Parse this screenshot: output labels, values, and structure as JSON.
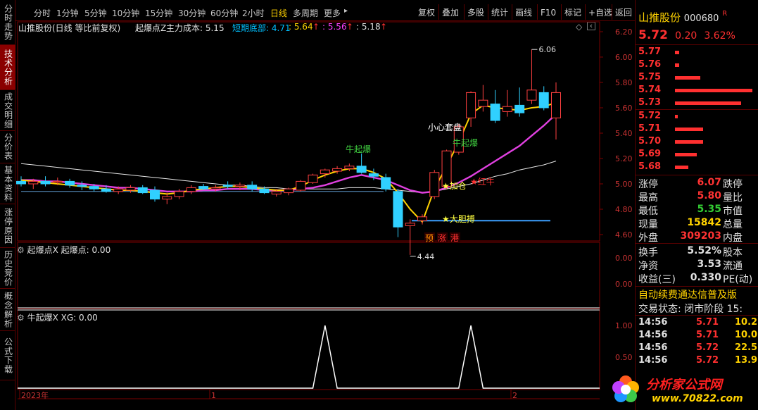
{
  "left_tabs": [
    {
      "label": "分时走势",
      "active": false
    },
    {
      "label": "技术分析",
      "active": true
    },
    {
      "label": "成交明细",
      "active": false
    },
    {
      "label": "分价表",
      "active": false
    },
    {
      "label": "基本资料",
      "active": false
    },
    {
      "label": "涨停原因",
      "active": false
    },
    {
      "label": "历史竞价",
      "active": false
    },
    {
      "label": "概念解析",
      "active": false
    },
    {
      "label": "公式下载",
      "active": false
    }
  ],
  "toolbar": {
    "periods": [
      "分时",
      "1分钟",
      "5分钟",
      "10分钟",
      "15分钟",
      "30分钟",
      "60分钟",
      "2小时",
      "日线",
      "多周期",
      "更多"
    ],
    "active_period": "日线",
    "more_arrow": "▸",
    "buttons": [
      "复权",
      "叠加",
      "多股",
      "统计",
      "画线",
      "F10",
      "标记",
      "+自选",
      "返回"
    ]
  },
  "header": {
    "title": "山推股份(日线 等比前复权)",
    "indicator_name": "起爆点Z",
    "cost_label": "主力成本: 5.15",
    "bottom_label": "短期底部: 4.71",
    "v1": ": 5.64",
    "v2": ": 5.56",
    "v3": ": 5.18",
    "arrow": "↑"
  },
  "chart": {
    "y_ticks": [
      "6.20",
      "6.00",
      "5.80",
      "5.60",
      "5.40",
      "5.20",
      "5.00",
      "4.80",
      "4.60"
    ],
    "high_label": "6.06",
    "low_label": "4.44",
    "annotations": {
      "xiaoxin": "小心套盘",
      "niu1": "牛起爆",
      "niu2": "牛起爆",
      "jiacang": "★加仓",
      "hongniu": "★红牛",
      "dadan": "★大胆搏"
    },
    "badges": [
      "预",
      "涨",
      "港"
    ]
  },
  "chart_data": [
    {
      "type": "candlestick",
      "title": "山推股份(日线 等比前复权)",
      "ylim": [
        4.55,
        6.25
      ],
      "candles": [
        {
          "o": 5.02,
          "h": 5.06,
          "l": 4.98,
          "c": 5.0
        },
        {
          "o": 5.0,
          "h": 5.04,
          "l": 4.96,
          "c": 5.02
        },
        {
          "o": 5.02,
          "h": 5.06,
          "l": 4.98,
          "c": 5.0
        },
        {
          "o": 5.02,
          "h": 5.05,
          "l": 4.99,
          "c": 5.02
        },
        {
          "o": 5.02,
          "h": 5.04,
          "l": 4.97,
          "c": 4.99
        },
        {
          "o": 4.99,
          "h": 5.02,
          "l": 4.95,
          "c": 4.98
        },
        {
          "o": 4.98,
          "h": 5.0,
          "l": 4.94,
          "c": 4.96
        },
        {
          "o": 4.96,
          "h": 4.99,
          "l": 4.93,
          "c": 4.94
        },
        {
          "o": 4.94,
          "h": 4.98,
          "l": 4.92,
          "c": 4.96
        },
        {
          "o": 4.95,
          "h": 4.99,
          "l": 4.93,
          "c": 4.97
        },
        {
          "o": 4.97,
          "h": 4.99,
          "l": 4.92,
          "c": 4.93
        },
        {
          "o": 4.95,
          "h": 4.98,
          "l": 4.86,
          "c": 4.88
        },
        {
          "o": 4.88,
          "h": 4.93,
          "l": 4.84,
          "c": 4.9
        },
        {
          "o": 4.9,
          "h": 4.96,
          "l": 4.88,
          "c": 4.94
        },
        {
          "o": 4.94,
          "h": 4.99,
          "l": 4.92,
          "c": 4.97
        },
        {
          "o": 4.98,
          "h": 5.0,
          "l": 4.95,
          "c": 4.96
        },
        {
          "o": 4.96,
          "h": 4.99,
          "l": 4.94,
          "c": 4.97
        },
        {
          "o": 4.99,
          "h": 5.02,
          "l": 4.96,
          "c": 4.98
        },
        {
          "o": 4.98,
          "h": 5.01,
          "l": 4.95,
          "c": 4.99
        },
        {
          "o": 4.99,
          "h": 5.02,
          "l": 4.94,
          "c": 4.96
        },
        {
          "o": 4.96,
          "h": 4.98,
          "l": 4.92,
          "c": 4.93
        },
        {
          "o": 4.92,
          "h": 4.96,
          "l": 4.9,
          "c": 4.94
        },
        {
          "o": 4.93,
          "h": 4.97,
          "l": 4.91,
          "c": 4.96
        },
        {
          "o": 4.95,
          "h": 5.03,
          "l": 4.94,
          "c": 5.02
        },
        {
          "o": 5.01,
          "h": 5.08,
          "l": 5.0,
          "c": 5.07
        },
        {
          "o": 5.08,
          "h": 5.12,
          "l": 5.05,
          "c": 5.11
        },
        {
          "o": 5.1,
          "h": 5.14,
          "l": 5.08,
          "c": 5.12
        },
        {
          "o": 5.12,
          "h": 5.16,
          "l": 5.1,
          "c": 5.14
        },
        {
          "o": 5.14,
          "h": 5.24,
          "l": 5.08,
          "c": 5.09
        },
        {
          "o": 5.08,
          "h": 5.12,
          "l": 5.03,
          "c": 5.06
        },
        {
          "o": 5.05,
          "h": 5.08,
          "l": 4.94,
          "c": 4.96
        },
        {
          "o": 4.94,
          "h": 4.96,
          "l": 4.58,
          "c": 4.66
        },
        {
          "o": 4.67,
          "h": 4.72,
          "l": 4.44,
          "c": 4.69
        },
        {
          "o": 4.71,
          "h": 4.76,
          "l": 4.68,
          "c": 4.74
        },
        {
          "o": 4.9,
          "h": 5.11,
          "l": 4.88,
          "c": 5.09
        },
        {
          "o": 4.98,
          "h": 5.27,
          "l": 4.96,
          "c": 5.26
        },
        {
          "o": 5.25,
          "h": 5.47,
          "l": 5.23,
          "c": 5.45
        },
        {
          "o": 5.52,
          "h": 5.73,
          "l": 5.45,
          "c": 5.72
        },
        {
          "o": 5.61,
          "h": 5.78,
          "l": 5.57,
          "c": 5.66
        },
        {
          "o": 5.63,
          "h": 5.74,
          "l": 5.48,
          "c": 5.5
        },
        {
          "o": 5.57,
          "h": 5.74,
          "l": 5.53,
          "c": 5.61
        },
        {
          "o": 5.62,
          "h": 5.76,
          "l": 5.53,
          "c": 5.56
        },
        {
          "o": 5.66,
          "h": 6.06,
          "l": 5.63,
          "c": 5.74
        },
        {
          "o": 5.72,
          "h": 5.77,
          "l": 5.58,
          "c": 5.6
        },
        {
          "o": 5.52,
          "h": 5.8,
          "l": 5.35,
          "c": 5.72
        }
      ],
      "cost_line": [
        5.03,
        5.03,
        5.02,
        5.02,
        5.01,
        5.0,
        4.99,
        4.98,
        4.97,
        4.97,
        4.96,
        4.95,
        4.94,
        4.94,
        4.94,
        4.95,
        4.95,
        4.96,
        4.96,
        4.96,
        4.95,
        4.95,
        4.95,
        4.96,
        4.97,
        4.99,
        5.02,
        5.05,
        5.07,
        5.05,
        5.03,
        4.99,
        4.95,
        4.93,
        4.94,
        4.97,
        5.01,
        5.06,
        5.12,
        5.18,
        5.24,
        5.3,
        5.38,
        5.46,
        5.55
      ],
      "yellow_line": [
        5.03,
        5.02,
        5.01,
        5.0,
        4.99,
        4.98,
        4.97,
        4.96,
        4.95,
        4.95,
        4.94,
        4.93,
        4.92,
        4.93,
        4.95,
        4.96,
        4.97,
        4.98,
        4.98,
        4.97,
        4.96,
        4.95,
        4.95,
        4.98,
        5.03,
        5.07,
        5.1,
        5.12,
        5.12,
        5.09,
        5.04,
        4.93,
        4.8,
        4.7,
        4.96,
        5.14,
        5.33,
        5.55,
        5.62,
        5.6,
        5.59,
        5.58,
        5.6,
        5.61,
        5.64
      ],
      "white_line": [
        5.16,
        5.15,
        5.14,
        5.13,
        5.12,
        5.11,
        5.1,
        5.09,
        5.08,
        5.07,
        5.06,
        5.05,
        5.04,
        5.03,
        5.02,
        5.01,
        5.0,
        4.99,
        4.99,
        4.98,
        4.97,
        4.97,
        4.96,
        4.96,
        4.96,
        4.96,
        4.96,
        4.97,
        4.97,
        4.97,
        4.96,
        4.95,
        4.94,
        4.93,
        4.94,
        4.96,
        4.98,
        5.0,
        5.03,
        5.06,
        5.08,
        5.11,
        5.13,
        5.15,
        5.18
      ],
      "blue_level": 4.71,
      "teal_level": 4.94
    },
    {
      "type": "line",
      "title": "起爆点X",
      "series": [
        {
          "name": "起爆点",
          "values": [
            0
          ]
        }
      ],
      "ylim": [
        0,
        1
      ],
      "y_ticks": [
        "0.00",
        "0.00"
      ]
    },
    {
      "type": "line",
      "title": "牛起爆X",
      "series": [
        {
          "name": "XG",
          "values": [
            0,
            0,
            0,
            0,
            0,
            0,
            0,
            0,
            0,
            0,
            0,
            0,
            0,
            0,
            0,
            0,
            0,
            0,
            0,
            0,
            0,
            0,
            0,
            0,
            0,
            1,
            0,
            0,
            0,
            0,
            0,
            0,
            0,
            0,
            0,
            0,
            0,
            1,
            0,
            0,
            0,
            0,
            0,
            0,
            0
          ]
        }
      ],
      "ylim": [
        0,
        1
      ],
      "y_ticks": [
        "1.00",
        "0.50",
        "0.00"
      ],
      "x_labels": [
        "2023年",
        "1",
        "2"
      ]
    }
  ],
  "sub1_header": "起爆点X 起爆点: 0.00",
  "sub2_header": "牛起爆X XG: 0.00",
  "right_panel": {
    "stock_name": "山推股份",
    "stock_code": "000680",
    "r_mark": "R",
    "price": "5.72",
    "change": "0.20",
    "change_pct": "3.62%",
    "asks": [
      {
        "price": "5.77",
        "bar": 0.05
      },
      {
        "price": "5.76",
        "bar": 0.05
      },
      {
        "price": "5.75",
        "bar": 0.33
      },
      {
        "price": "5.74",
        "bar": 1.0
      },
      {
        "price": "5.73",
        "bar": 0.85
      }
    ],
    "bids": [
      {
        "price": "5.72",
        "bar": 0.03
      },
      {
        "price": "5.71",
        "bar": 0.36
      },
      {
        "price": "5.70",
        "bar": 0.36
      },
      {
        "price": "5.69",
        "bar": 0.28
      },
      {
        "price": "5.68",
        "bar": 0.17
      }
    ],
    "stats": [
      {
        "l": "涨停",
        "v": "6.07",
        "c": "#ff3333",
        "r": "跌停"
      },
      {
        "l": "最高",
        "v": "5.80",
        "c": "#ff3333",
        "r": "量比"
      },
      {
        "l": "最低",
        "v": "5.35",
        "c": "#33cc33",
        "r": "市值"
      },
      {
        "l": "现量",
        "v": "15842",
        "c": "#ffd200",
        "r": "总量"
      },
      {
        "l": "外盘",
        "v": "309203",
        "c": "#ff3333",
        "r": "内盘"
      }
    ],
    "stats2": [
      {
        "l": "换手",
        "v": "5.52%",
        "r": "股本"
      },
      {
        "l": "净资",
        "v": "3.53",
        "r": "流通"
      },
      {
        "l": "收益(三)",
        "v": "0.330",
        "r": "PE(动)"
      }
    ],
    "promo": "自动续费通达信普及版",
    "trade_status": "交易状态: 闭市阶段 15:",
    "ticks": [
      {
        "t": "14:56",
        "p": "5.71",
        "v": "10.2"
      },
      {
        "t": "14:56",
        "p": "5.71",
        "v": "10.0"
      },
      {
        "t": "14:56",
        "p": "5.72",
        "v": "22.5"
      },
      {
        "t": "14:56",
        "p": "5.72",
        "v": "13.9"
      }
    ]
  },
  "watermark": {
    "text": "分析家公式网",
    "url": "www.70822.com"
  }
}
